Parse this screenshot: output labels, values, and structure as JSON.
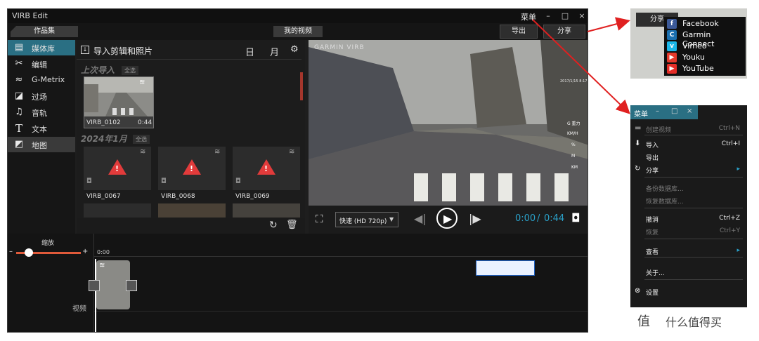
{
  "app": {
    "title": "VIRB Edit",
    "menu_label": "菜单",
    "win_min": "–",
    "win_max": "□",
    "win_close": "×"
  },
  "header": {
    "collections_tab": "作品集",
    "my_videos_tab": "我的视频",
    "export_button": "导出",
    "share_button": "分享"
  },
  "sidebar": {
    "items": [
      {
        "label": "媒体库",
        "icon": "film-icon"
      },
      {
        "label": "编辑",
        "icon": "scissors-icon"
      },
      {
        "label": "G-Metrix",
        "icon": "gmetrix-icon"
      },
      {
        "label": "过场",
        "icon": "transition-icon"
      },
      {
        "label": "音轨",
        "icon": "music-note-icon"
      },
      {
        "label": "文本",
        "icon": "text-icon"
      },
      {
        "label": "地图",
        "icon": "map-icon"
      }
    ]
  },
  "media": {
    "title": "导入剪辑和照片",
    "view_day": "日",
    "view_month": "月",
    "sections": [
      {
        "title": "上次导入",
        "select_all": "全选",
        "items": [
          {
            "name": "VIRB_0102",
            "duration": "0:44"
          }
        ]
      },
      {
        "title": "2024年1月",
        "select_all": "全选",
        "items": [
          {
            "name": "VIRB_0067"
          },
          {
            "name": "VIRB_0068"
          },
          {
            "name": "VIRB_0069"
          }
        ]
      }
    ]
  },
  "preview": {
    "watermark": "GARMIN VIRB",
    "overlay_date": "2017/1/15 8:17",
    "gauges": [
      {
        "value": "",
        "unit": "G 重力"
      },
      {
        "value": "",
        "unit": "KM/H"
      },
      {
        "value": "",
        "unit": "%"
      },
      {
        "value": "",
        "unit": "M"
      },
      {
        "value": "",
        "unit": "KM"
      }
    ]
  },
  "controls": {
    "speed": "快速 (HD 720p)",
    "current_time": "0:00",
    "time_separator": "/",
    "total_time": "0:44"
  },
  "timeline": {
    "zoom_label": "缩放",
    "zoom_minus": "–",
    "zoom_plus": "+",
    "start_time": "0:00",
    "track_label": "视频",
    "zoom_level": 0.2
  },
  "share_popup": {
    "button": "分享",
    "items": [
      {
        "label": "Facebook",
        "icon": "facebook-icon",
        "color": "#3b5998"
      },
      {
        "label": "Garmin Connect",
        "icon": "garmin-connect-icon",
        "color": "#1a6fb0"
      },
      {
        "label": "Vimeo",
        "icon": "vimeo-icon",
        "color": "#1ab7ea"
      },
      {
        "label": "Youku",
        "icon": "youku-icon",
        "color": "#e43a2c"
      },
      {
        "label": "YouTube",
        "icon": "youtube-icon",
        "color": "#e52d27"
      }
    ]
  },
  "main_menu": {
    "title": "菜单",
    "items": [
      {
        "label": "创建视频",
        "shortcut": "Ctrl+N",
        "enabled": false,
        "icon": "video-icon"
      },
      {
        "label": "导入",
        "shortcut": "Ctrl+I",
        "enabled": true,
        "icon": "import-icon"
      },
      {
        "label": "导出",
        "shortcut": "",
        "enabled": true,
        "icon": ""
      },
      {
        "label": "分享",
        "shortcut": "",
        "enabled": true,
        "icon": "share-icon",
        "submenu": true
      },
      {
        "label": "备份数据库...",
        "shortcut": "",
        "enabled": false,
        "icon": ""
      },
      {
        "label": "恢复数据库...",
        "shortcut": "",
        "enabled": false,
        "icon": ""
      },
      {
        "label": "撤消",
        "shortcut": "Ctrl+Z",
        "enabled": true,
        "icon": ""
      },
      {
        "label": "恢复",
        "shortcut": "Ctrl+Y",
        "enabled": false,
        "icon": ""
      },
      {
        "label": "查看",
        "shortcut": "",
        "enabled": true,
        "icon": "",
        "submenu": true
      },
      {
        "label": "关于...",
        "shortcut": "",
        "enabled": true,
        "icon": ""
      },
      {
        "label": "设置",
        "shortcut": "",
        "enabled": true,
        "icon": "settings-icon"
      }
    ]
  },
  "watermark": {
    "brand": "什么值得买"
  },
  "colors": {
    "accent": "#2a6f83",
    "arrow": "#e02020",
    "warning": "#e23b3b",
    "time_accent": "#2aa0c8"
  }
}
